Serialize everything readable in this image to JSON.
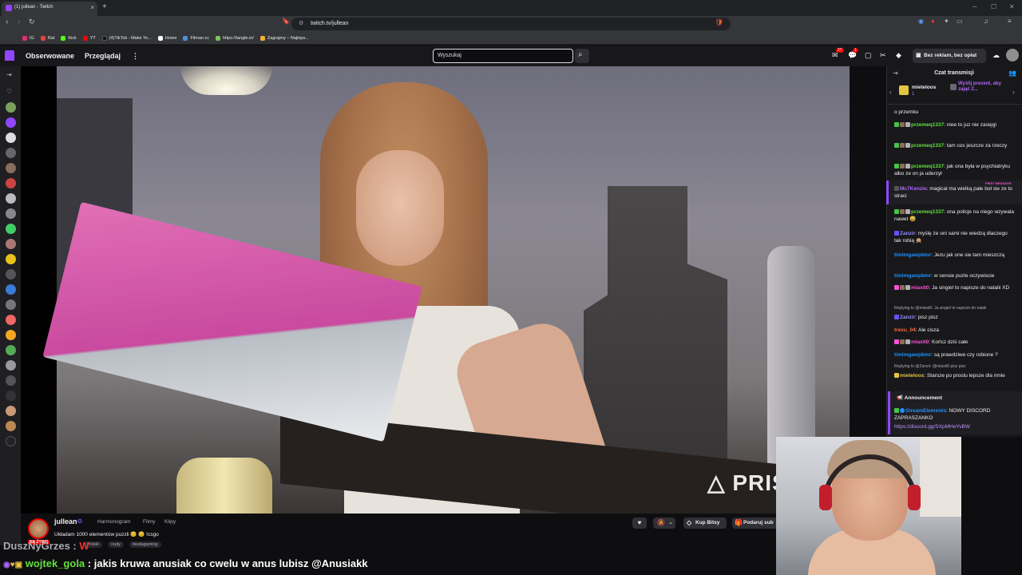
{
  "browser": {
    "tab_title": "(1) jullean - Twitch",
    "new_tab": "+",
    "url": "twitch.tv/jullean",
    "bookmarks": [
      {
        "label": "IG",
        "color": "#e1306c"
      },
      {
        "label": "Rat",
        "color": "#e0453a"
      },
      {
        "label": "Kick",
        "color": "#53fc18"
      },
      {
        "label": "YT",
        "color": "#ff0000"
      },
      {
        "label": "(4)TikTok - Make Yo...",
        "color": "#111111"
      },
      {
        "label": "Home",
        "color": "#ffffff"
      },
      {
        "label": "Filman.cc",
        "color": "#4a90d9"
      },
      {
        "label": "https://tangle.io/",
        "color": "#7cc35a"
      },
      {
        "label": "Zagrajmy – Najleps...",
        "color": "#f2b233"
      }
    ]
  },
  "twitch_nav": {
    "following": "Obserwowane",
    "browse": "Przeglądaj",
    "search_placeholder": "Wyszukaj",
    "notifications_count": "27",
    "whispers_count": "1",
    "no_ads": "Bez reklam, bez opłat"
  },
  "stream": {
    "streamer": "jullean",
    "live_badge": "NA ŻYWO",
    "tabs": [
      "Harmonogram",
      "Filmy",
      "Klipy"
    ],
    "title": "Układam 1000 elementów puzzli 😊 😊 !csgo",
    "tags": [
      "Polski",
      "nudy",
      "biedagaming"
    ],
    "bits_button": "Kup Bitsy",
    "sub_button": "Podaruj sub",
    "watermark": "PRISM"
  },
  "chat": {
    "header": "Czat transmisji",
    "gift_user": "mieteloos",
    "gift_count": "1",
    "gift_cta": "Wyślij prezent, aby zająć 2...",
    "messages": [
      {
        "user": "",
        "color": "#efeff1",
        "text": "o przemku"
      },
      {
        "user": "przemeq1337",
        "color": "#62e03d",
        "text": ": niee to juz nie zasięgi"
      },
      {
        "user": "przemeq1337",
        "color": "#62e03d",
        "text": ": tam cos jeszcze za rzeczy"
      },
      {
        "user": "przemeq1337",
        "color": "#62e03d",
        "text": ": jak ona była w psychiatryku albo ze on ja uderzył"
      },
      {
        "user": "Mc7Kenzie",
        "color": "#b266ff",
        "text": ": magical ma wielką pałe boł sie ze to straci"
      },
      {
        "user": "przemeq1337",
        "color": "#62e03d",
        "text": ": ona policje na niego wzywala nawet 😅"
      },
      {
        "user": "Zanzir",
        "color": "#8f8fff",
        "text": ": myślę że oni sami nie wiedzą dlaczego tak robią 🙊"
      },
      {
        "user": "timimgawpbmr",
        "color": "#1e90ff",
        "text": ": Jezu jak one sie tam mieszczą"
      },
      {
        "user": "timimgawpbmr",
        "color": "#1e90ff",
        "text": ": w sensie puzle oczywiscie"
      },
      {
        "user": "miaxit0",
        "color": "#ff4fd8",
        "text": ": Ja singiel to napisze do natalii XD"
      },
      {
        "user": "Zanzir",
        "color": "#8f8fff",
        "text": ": pisz pisz"
      },
      {
        "user": "trexu_04",
        "color": "#ff6b3d",
        "text": ": Ale cisza"
      },
      {
        "user": "miaxit0",
        "color": "#ff4fd8",
        "text": ": Kończ dziś całe"
      },
      {
        "user": "timimgawpbmr",
        "color": "#1e90ff",
        "text": ": są prawdziwe czy robione ?"
      },
      {
        "user": "mieteloos",
        "color": "#e4c441",
        "text": ": Starsze po prostu lepsze dla mnie"
      }
    ],
    "replies": [
      "Replying to @miaxit0: Ja singiel to napisze do natali",
      "Replying to @Zanzir: @miaxit0 pisz pisz"
    ],
    "announcement_label": "Announcement",
    "announcement_user": "StreamElements",
    "announcement_text": ": NOWY DISCORD ZAPRASZANKO",
    "announcement_link": "https://discord.gg/SXpMHeYvBW",
    "first_message_tag": "FIRST MESSAGE"
  },
  "overlay_chat": {
    "line1_user": "DuszNyGrzes :",
    "line2_user": "wojtek_gola",
    "line2_text": " : jakis kruwa anusiak co cwelu w anus lubisz @Anusiakk"
  },
  "colors": {
    "twitch_purple": "#9146ff",
    "live_red": "#eb0400",
    "chat_bg": "#18181b"
  }
}
